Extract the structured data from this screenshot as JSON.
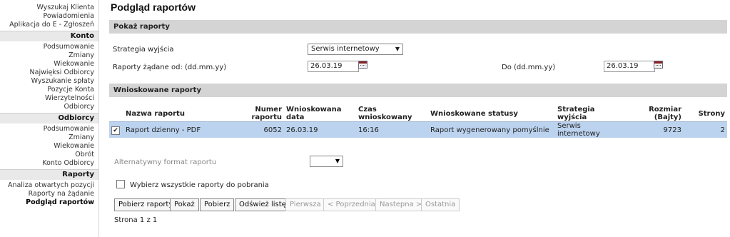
{
  "sidebar": {
    "top_items": [
      "Wyszukaj Klienta",
      "Powiadomienia",
      "Aplikacja do E - Zgłoszeń"
    ],
    "konto": {
      "title": "Konto",
      "items": [
        "Podsumowanie",
        "Zmiany",
        "Wiekowanie",
        "Najwięksi Odbiorcy",
        "Wyszukanie spłaty",
        "Pozycje Konta",
        "Wierzytelności",
        "Odbiorcy"
      ]
    },
    "odbiorcy": {
      "title": "Odbiorcy",
      "items": [
        "Podsumowanie",
        "Zmiany",
        "Wiekowanie",
        "Obrót",
        "Konto Odbiorcy"
      ]
    },
    "raporty": {
      "title": "Raporty",
      "items": [
        "Analiza otwartych pozycji",
        "Raporty na żądanie",
        "Podgląd raportów"
      ]
    }
  },
  "page": {
    "title": "Podgląd raportów"
  },
  "filter": {
    "section_title": "Pokaż raporty",
    "strategy_label": "Strategia wyjścia",
    "strategy_value": "Serwis internetowy",
    "date_from_label": "Raporty żądane od: (dd.mm.yy)",
    "date_from_value": "26.03.19",
    "date_to_label": "Do (dd.mm.yy)",
    "date_to_value": "26.03.19"
  },
  "reports": {
    "section_title": "Wnioskowane raporty",
    "columns": [
      "Nazwa raportu",
      "Numer raportu",
      "Wnioskowana data",
      "Czas wnioskowany",
      "Wnioskowane statusy",
      "Strategia wyjścia",
      "Rozmiar (Bajty)",
      "Strony"
    ],
    "rows": [
      {
        "checked": "✔",
        "name": "Raport dzienny - PDF",
        "number": "6052",
        "date": "26.03.19",
        "time": "16:16",
        "status": "Raport wygenerowany pomyślnie",
        "strategy": "Serwis internetowy",
        "size": "9723",
        "pages": "2"
      }
    ]
  },
  "options": {
    "alt_format_label": "Alternatywny format raportu",
    "alt_format_value": "",
    "select_all_label": "Wybierz wszystkie raporty do pobrania"
  },
  "buttons": {
    "fetch": "Pobierz raporty",
    "show": "Pokaż",
    "download": "Pobierz",
    "refresh": "Odśwież listę",
    "first": "Pierwsza",
    "prev": "< Poprzednia",
    "next": "Nastepna >",
    "last": "Ostatnia"
  },
  "pagination": {
    "text": "Strona 1 z 1"
  },
  "colors": {
    "section_bg": "#d4d4d4",
    "row_selected": "#bcd3ef",
    "sidebar_section_bg": "#e9e9e9"
  }
}
